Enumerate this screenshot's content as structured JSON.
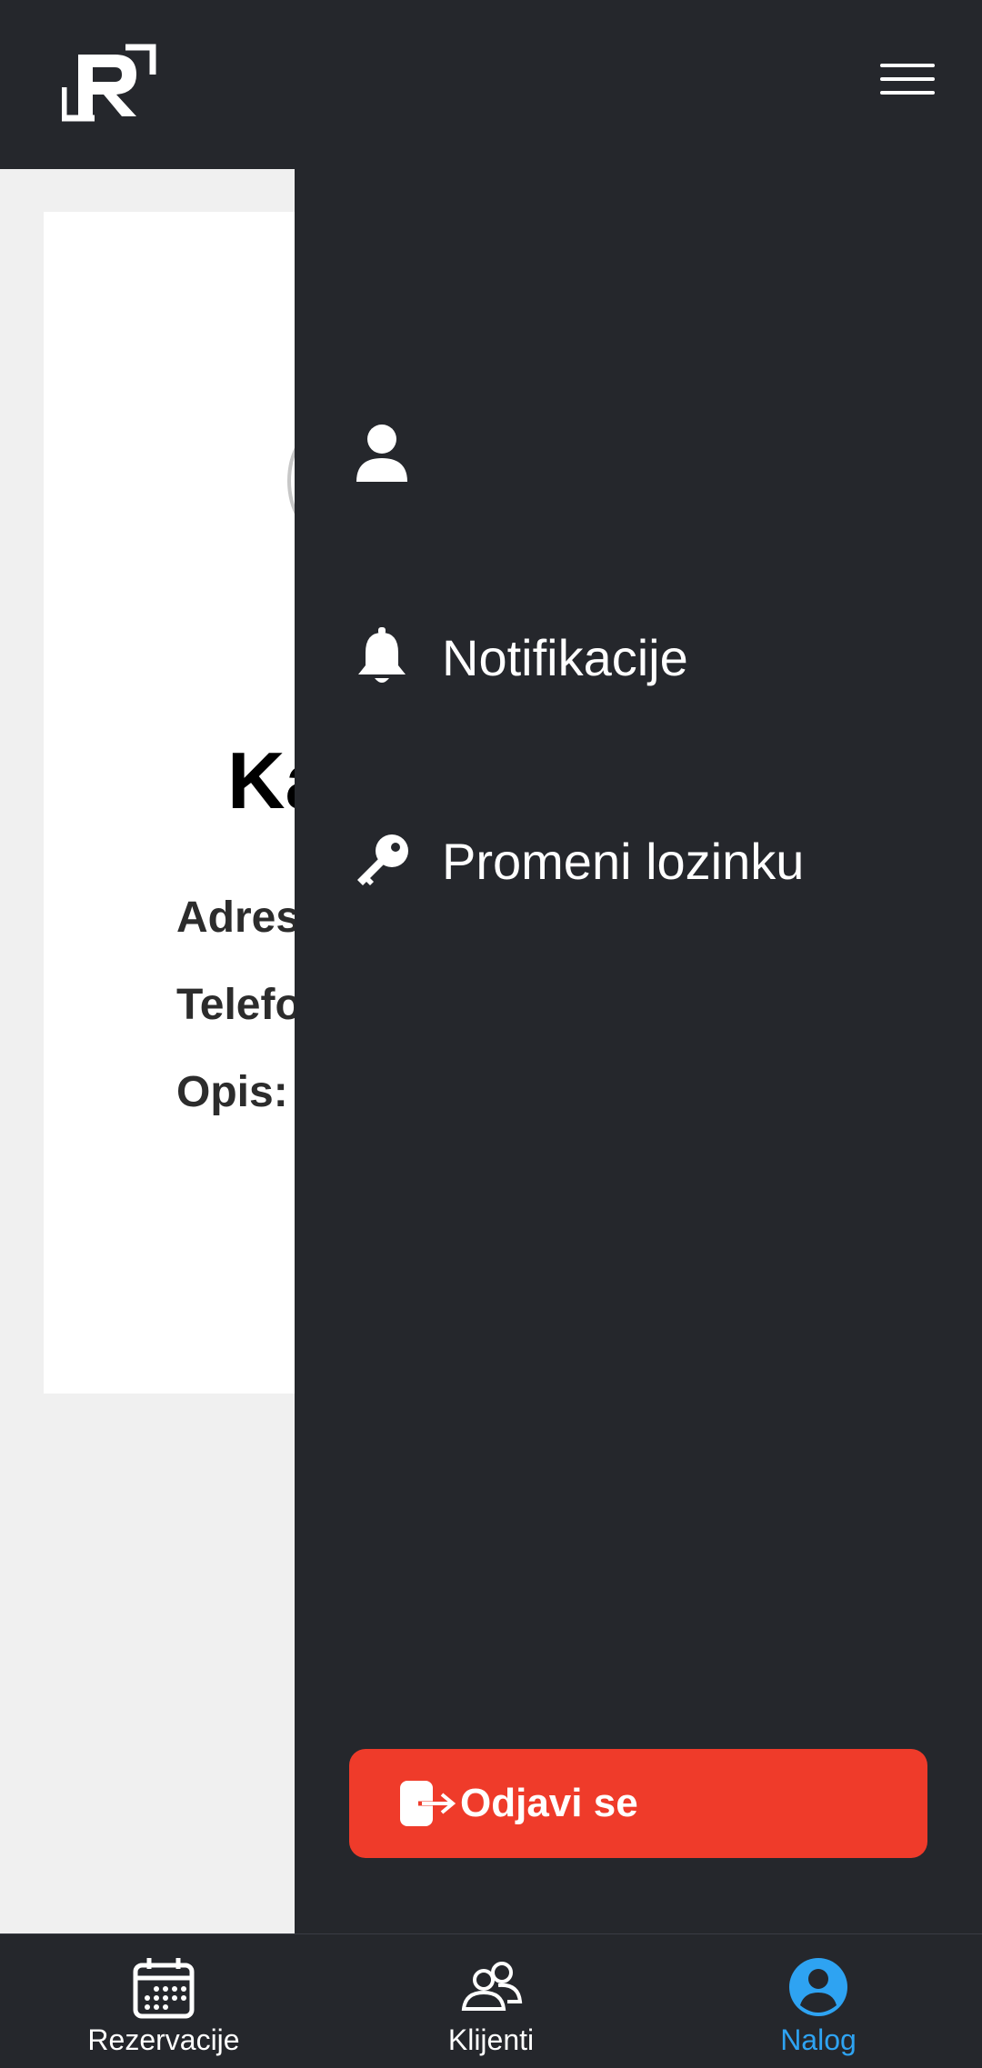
{
  "header": {
    "logo_icon": "r-logo-icon",
    "menu_icon": "hamburger-icon"
  },
  "profile": {
    "name_fragment": "Ka",
    "fields": [
      "Adres",
      "Telefo",
      "Opis:"
    ]
  },
  "drawer": {
    "items": [
      {
        "icon": "user-icon",
        "label": ""
      },
      {
        "icon": "bell-icon",
        "label": "Notifikacije"
      },
      {
        "icon": "key-icon",
        "label": "Promeni lozinku"
      }
    ],
    "logout": {
      "icon": "logout-icon",
      "label": "Odjavi se",
      "color": "#ef3b2a"
    }
  },
  "bottom_nav": {
    "items": [
      {
        "icon": "calendar-icon",
        "label": "Rezervacije",
        "active": false
      },
      {
        "icon": "users-icon",
        "label": "Klijenti",
        "active": false
      },
      {
        "icon": "account-circle-icon",
        "label": "Nalog",
        "active": true
      }
    ],
    "active_color": "#2ea3f2"
  },
  "colors": {
    "dark": "#25272c",
    "background": "#f0f0f0"
  }
}
